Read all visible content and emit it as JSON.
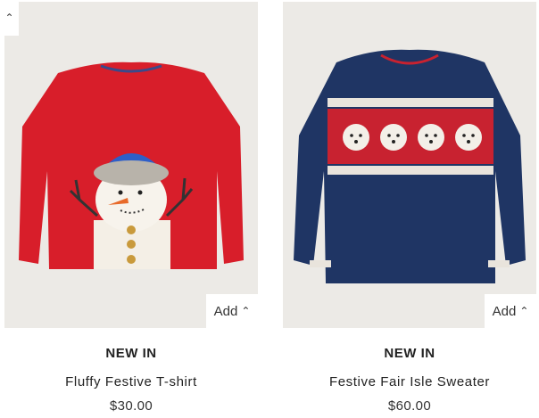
{
  "nav": {
    "scroll_up_icon": "chevron-up-icon"
  },
  "products": [
    {
      "badge": "NEW IN",
      "name": "Fluffy Festive T-shirt",
      "price": "$30.00",
      "add_label": "Add",
      "image_colors": {
        "garment": "#d81e2a",
        "background": "#eceae6"
      }
    },
    {
      "badge": "NEW IN",
      "name": "Festive Fair Isle Sweater",
      "price": "$60.00",
      "add_label": "Add",
      "image_colors": {
        "garment": "#1f3564",
        "band": "#c82230",
        "background": "#eceae6"
      }
    }
  ]
}
